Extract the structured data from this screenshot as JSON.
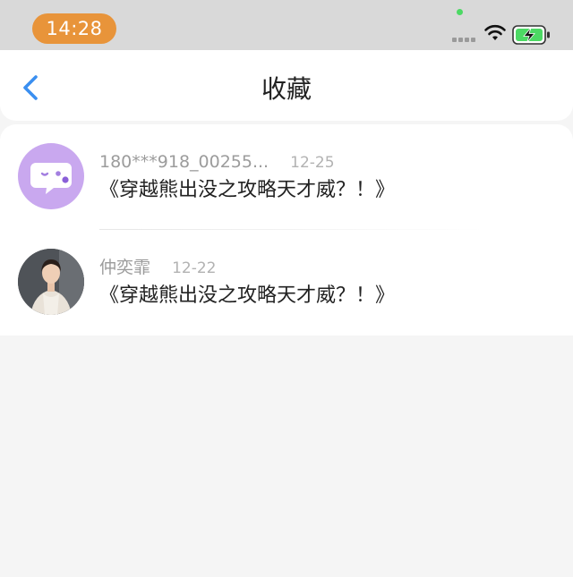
{
  "status_bar": {
    "time": "14:28",
    "icons": [
      "signal-icon",
      "wifi-icon",
      "battery-charging-icon"
    ],
    "time_pill_color": "#e8943a"
  },
  "nav": {
    "back_icon": "chevron-left-icon",
    "title": "收藏",
    "accent_color": "#3a8ff0"
  },
  "favorites": [
    {
      "name": "180***918_00255...",
      "date": "12-25",
      "text": "《穿越熊出没之攻略天才威？！》",
      "avatar": "chat-bubble-wink-icon"
    },
    {
      "name": "仲奕霏",
      "date": "12-22",
      "text": "《穿越熊出没之攻略天才威？！》",
      "avatar": "user-photo"
    }
  ]
}
